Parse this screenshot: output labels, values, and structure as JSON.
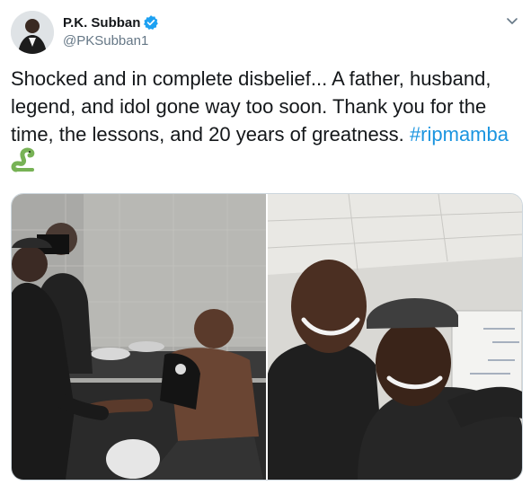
{
  "author": {
    "display_name": "P.K. Subban",
    "handle": "@PKSubban1",
    "verified": true
  },
  "tweet": {
    "text_main": "Shocked and in complete disbelief... A father, husband, legend, and idol gone way too soon. Thank you for the time, the lessons, and 20 years of greatness.",
    "hashtag": "#ripmamba",
    "emoji": "snake-emoji-icon"
  },
  "media": {
    "photo_count": 2
  },
  "colors": {
    "hashtag": "#1b95e0",
    "verified_badge": "#1da1f2",
    "handle": "#657786",
    "border": "#ccd6dd"
  }
}
